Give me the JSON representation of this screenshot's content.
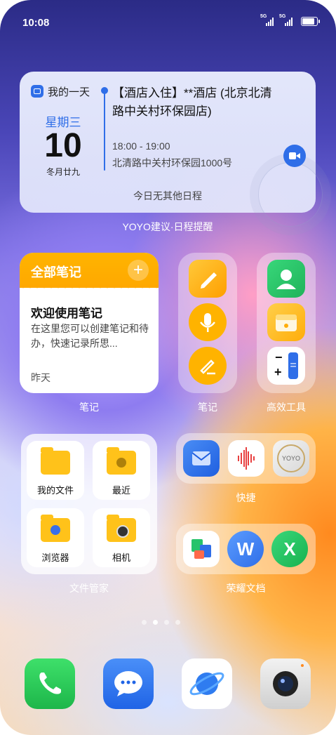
{
  "status_bar": {
    "time": "10:08",
    "signal1": "5G",
    "signal2": "5G"
  },
  "calendar": {
    "app_name": "我的一天",
    "weekday": "星期三",
    "day": "10",
    "lunar": "冬月廿九",
    "event_title": "【酒店入住】**酒店 (北京北清路中关村环保园店)",
    "event_time": "18:00 - 19:00",
    "event_place": "北清路中关村环保园1000号",
    "no_more": "今日无其他日程",
    "label": "YOYO建议·日程提醒"
  },
  "notes_widget": {
    "header": "全部笔记",
    "add": "+",
    "title": "欢迎使用笔记",
    "body": "在这里您可以创建笔记和待办，快速记录所思...",
    "date": "昨天",
    "label": "笔记"
  },
  "notes_shortcuts": {
    "label": "笔记"
  },
  "tools": {
    "label": "高效工具",
    "calc_minus": "−",
    "calc_plus": "+",
    "calc_eq": "="
  },
  "file_manager": {
    "label": "文件管家",
    "tiles": [
      "我的文件",
      "最近",
      "浏览器",
      "相机"
    ]
  },
  "quick": {
    "label": "快捷",
    "yoyo": "YOYO"
  },
  "docs": {
    "label": "荣耀文档",
    "word": "W",
    "excel": "X"
  },
  "page_dots": {
    "count": 4,
    "active": 1
  },
  "colors": {
    "accent_blue": "#2f6ee8",
    "notes_yellow": "#ffb400",
    "phone_green": "#25c84a"
  }
}
